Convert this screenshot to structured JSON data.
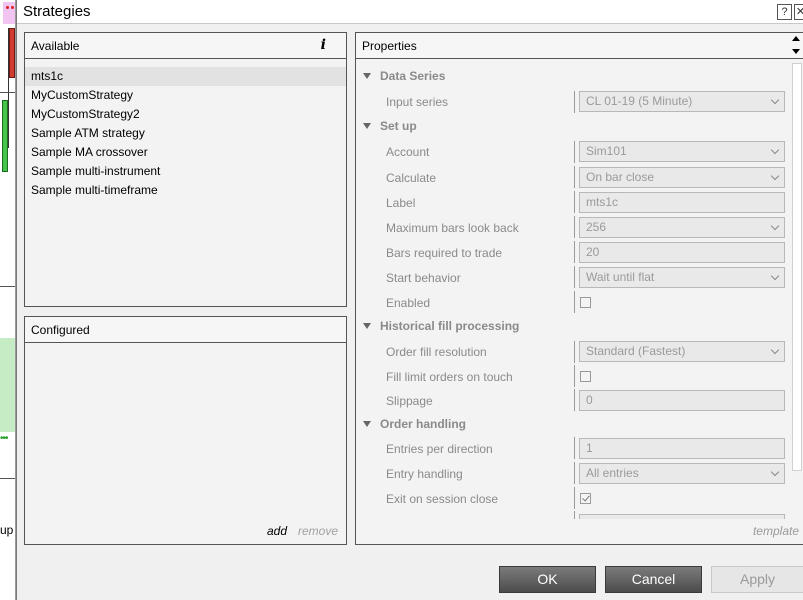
{
  "window": {
    "title": "Strategies",
    "help_label": "?",
    "close_label": "✕"
  },
  "background": {
    "partial_text": "up"
  },
  "available": {
    "header": "Available",
    "info_label": "i",
    "items": [
      "mts1c",
      "MyCustomStrategy",
      "MyCustomStrategy2",
      "Sample ATM strategy",
      "Sample MA crossover",
      "Sample multi-instrument",
      "Sample multi-timeframe"
    ],
    "selected_index": 0
  },
  "configured": {
    "header": "Configured",
    "add_label": "add",
    "remove_label": "remove"
  },
  "properties": {
    "header": "Properties",
    "template_label": "template",
    "categories": {
      "data_series": "Data Series",
      "set_up": "Set up",
      "historical_fill": "Historical fill processing",
      "order_handling": "Order handling"
    },
    "fields": {
      "input_series": {
        "label": "Input series",
        "value": "CL 01-19 (5 Minute)"
      },
      "account": {
        "label": "Account",
        "value": "Sim101"
      },
      "calculate": {
        "label": "Calculate",
        "value": "On bar close"
      },
      "label": {
        "label": "Label",
        "value": "mts1c"
      },
      "max_bars_look_back": {
        "label": "Maximum bars look back",
        "value": "256"
      },
      "bars_required": {
        "label": "Bars required to trade",
        "value": "20"
      },
      "start_behavior": {
        "label": "Start behavior",
        "value": "Wait until flat"
      },
      "enabled": {
        "label": "Enabled",
        "checked": false
      },
      "order_fill_resolution": {
        "label": "Order fill resolution",
        "value": "Standard (Fastest)"
      },
      "fill_limit_on_touch": {
        "label": "Fill limit orders on touch",
        "checked": false
      },
      "slippage": {
        "label": "Slippage",
        "value": "0"
      },
      "entries_per_direction": {
        "label": "Entries per direction",
        "value": "1"
      },
      "entry_handling": {
        "label": "Entry handling",
        "value": "All entries"
      },
      "exit_on_session_close": {
        "label": "Exit on session close",
        "checked": true
      }
    }
  },
  "buttons": {
    "ok": "OK",
    "cancel": "Cancel",
    "apply": "Apply"
  }
}
